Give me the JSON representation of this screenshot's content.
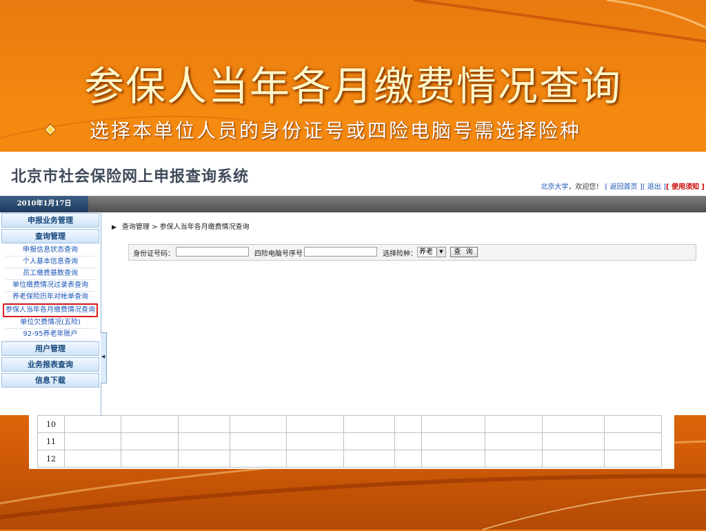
{
  "slide": {
    "title": "参保人当年各月缴费情况查询",
    "bullet": "选择本单位人员的身份证号或四险电脑号需选择险种"
  },
  "system": {
    "logo_text": "北京市社会保险网上申报查询系统",
    "user_name": "北京大学",
    "welcome": "，欢迎您！",
    "link_home": "[ 返回首页 ]",
    "link_logout": "[ 退出 ]",
    "link_notice": "[ 使用须知 ]",
    "date": "2010年1月17日"
  },
  "sidebar": {
    "sections": [
      {
        "label": "申报业务管理"
      },
      {
        "label": "查询管理"
      }
    ],
    "items": [
      {
        "label": "申报信息状态查询"
      },
      {
        "label": "个人基本信息查询"
      },
      {
        "label": "员工缴费基数查询"
      },
      {
        "label": "单位缴费情况过录表查询"
      },
      {
        "label": "养老保险历年对帐单查询"
      },
      {
        "label": "参保人当年各月缴费情况查询"
      },
      {
        "label": "单位欠费情况(五险)"
      },
      {
        "label": "92-95养老年账户"
      }
    ],
    "bottom_sections": [
      {
        "label": "用户管理"
      },
      {
        "label": "业务报表查询"
      },
      {
        "label": "信息下载"
      }
    ]
  },
  "content": {
    "breadcrumb_arrow": "▶",
    "breadcrumb": "查询管理 > 参保人当年各月缴费情况查询",
    "id_label": "身份证号码：",
    "id_value": "",
    "computer_no_label": "四险电脑号序号：",
    "computer_no_value": "",
    "insurance_label": "选择险种：",
    "insurance_selected": "养老",
    "query_button": "查 询"
  },
  "table": {
    "rows": [
      {
        "month": "10"
      },
      {
        "month": "11"
      },
      {
        "month": "12"
      }
    ],
    "empty_columns": 11
  },
  "colors": {
    "slide_orange": "#f58a10",
    "menu_blue": "#1a54b8",
    "active_border": "#d81c1c"
  }
}
